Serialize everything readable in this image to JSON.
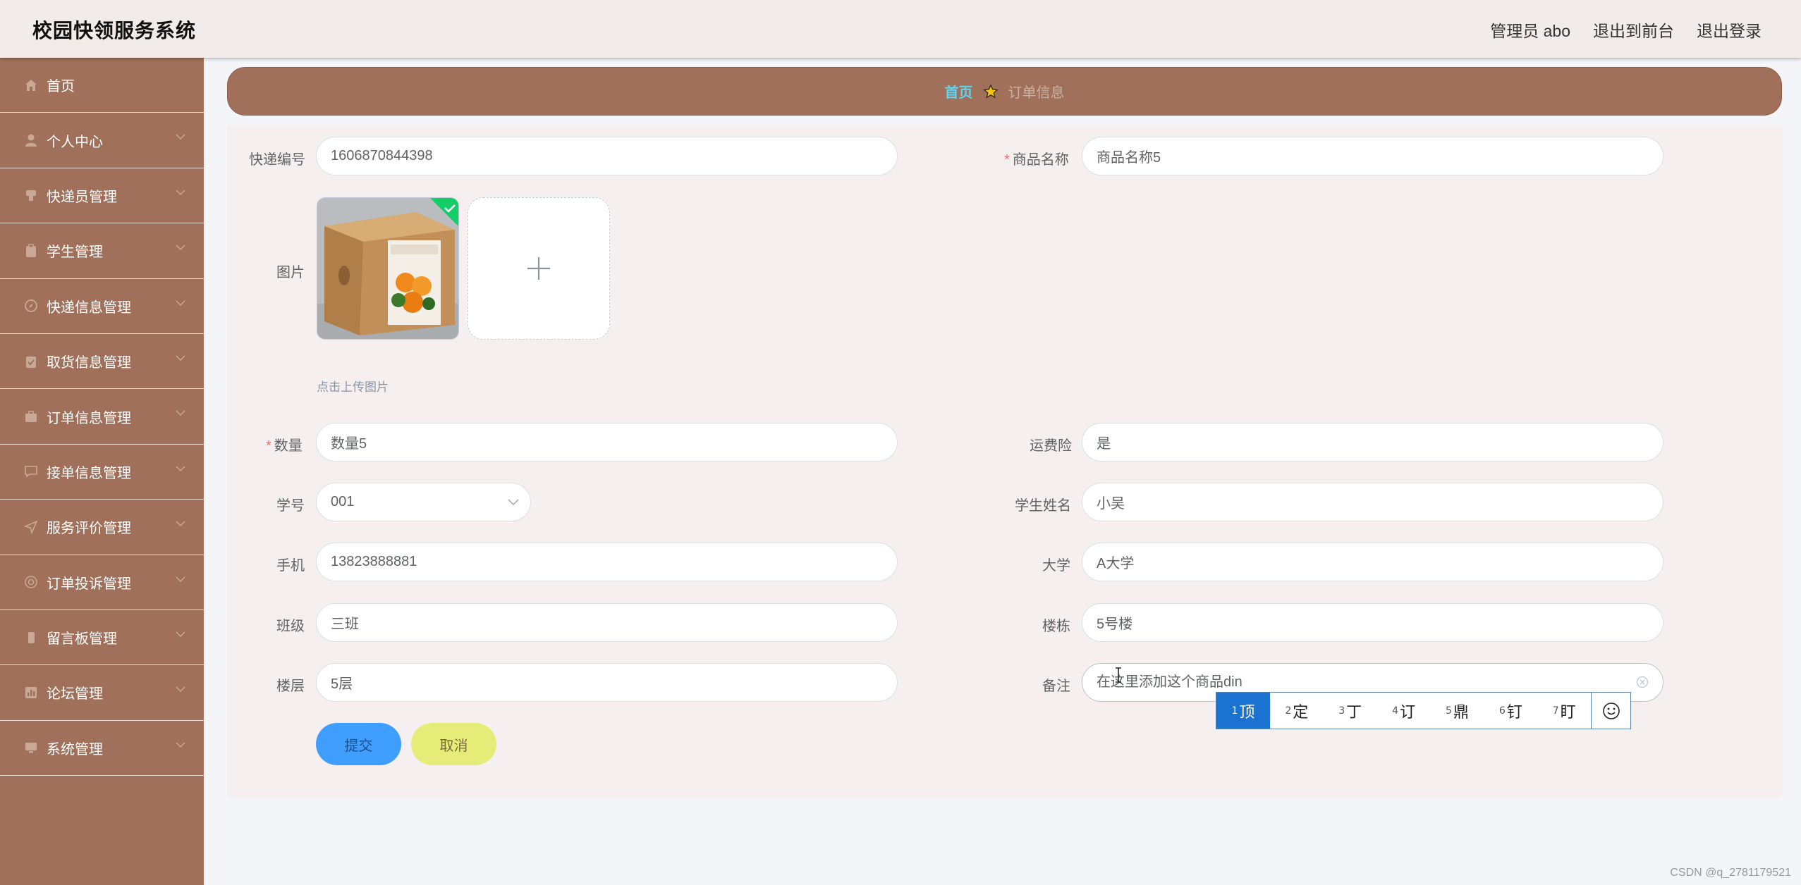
{
  "header": {
    "title": "校园快领服务系统",
    "admin": "管理员 abo",
    "to_front": "退出到前台",
    "logout": "退出登录"
  },
  "sidebar": {
    "items": [
      {
        "label": "首页",
        "icon": "home-icon",
        "has_arrow": false
      },
      {
        "label": "个人中心",
        "icon": "user-icon",
        "has_arrow": true
      },
      {
        "label": "快递员管理",
        "icon": "courier-icon",
        "has_arrow": true
      },
      {
        "label": "学生管理",
        "icon": "clipboard-icon",
        "has_arrow": true
      },
      {
        "label": "快递信息管理",
        "icon": "compass-icon",
        "has_arrow": true
      },
      {
        "label": "取货信息管理",
        "icon": "checklist-icon",
        "has_arrow": true
      },
      {
        "label": "订单信息管理",
        "icon": "briefcase-icon",
        "has_arrow": true
      },
      {
        "label": "接单信息管理",
        "icon": "chat-icon",
        "has_arrow": true
      },
      {
        "label": "服务评价管理",
        "icon": "send-icon",
        "has_arrow": true
      },
      {
        "label": "订单投诉管理",
        "icon": "help-icon",
        "has_arrow": true
      },
      {
        "label": "留言板管理",
        "icon": "phone-icon",
        "has_arrow": true
      },
      {
        "label": "论坛管理",
        "icon": "chart-icon",
        "has_arrow": true
      },
      {
        "label": "系统管理",
        "icon": "monitor-icon",
        "has_arrow": true
      }
    ]
  },
  "breadcrumb": {
    "home": "首页",
    "current": "订单信息"
  },
  "form": {
    "express_no": {
      "label": "快递编号",
      "value": "1606870844398"
    },
    "product_name": {
      "label": "商品名称",
      "value": "商品名称5"
    },
    "image": {
      "label": "图片",
      "tip": "点击上传图片",
      "box_label": "红美人橘子"
    },
    "quantity": {
      "label": "数量",
      "value": "数量5"
    },
    "shipping_insurance": {
      "label": "运费险",
      "value": "是"
    },
    "student_no": {
      "label": "学号",
      "value": "001"
    },
    "student_name": {
      "label": "学生姓名",
      "value": "小吴"
    },
    "phone": {
      "label": "手机",
      "value": "13823888881"
    },
    "university": {
      "label": "大学",
      "value": "A大学"
    },
    "class": {
      "label": "班级",
      "value": "三班"
    },
    "building": {
      "label": "楼栋",
      "value": "5号楼"
    },
    "floor": {
      "label": "楼层",
      "value": "5层"
    },
    "remark": {
      "label": "备注",
      "value": "在这里添加这个商品din"
    },
    "submit": "提交",
    "cancel": "取消"
  },
  "ime": {
    "candidates": [
      {
        "num": "1",
        "char": "顶"
      },
      {
        "num": "2",
        "char": "定"
      },
      {
        "num": "3",
        "char": "丁"
      },
      {
        "num": "4",
        "char": "订"
      },
      {
        "num": "5",
        "char": "鼎"
      },
      {
        "num": "6",
        "char": "钉"
      },
      {
        "num": "7",
        "char": "盯"
      }
    ],
    "emoji_icon": "smiley-icon"
  },
  "watermark": "CSDN @q_2781179521",
  "colors": {
    "sidebar": "#a0705a",
    "header": "#f1ebe9",
    "primary": "#409eff",
    "cancel": "#e6ec78",
    "breadcrumb_home": "#5fd3f0"
  }
}
